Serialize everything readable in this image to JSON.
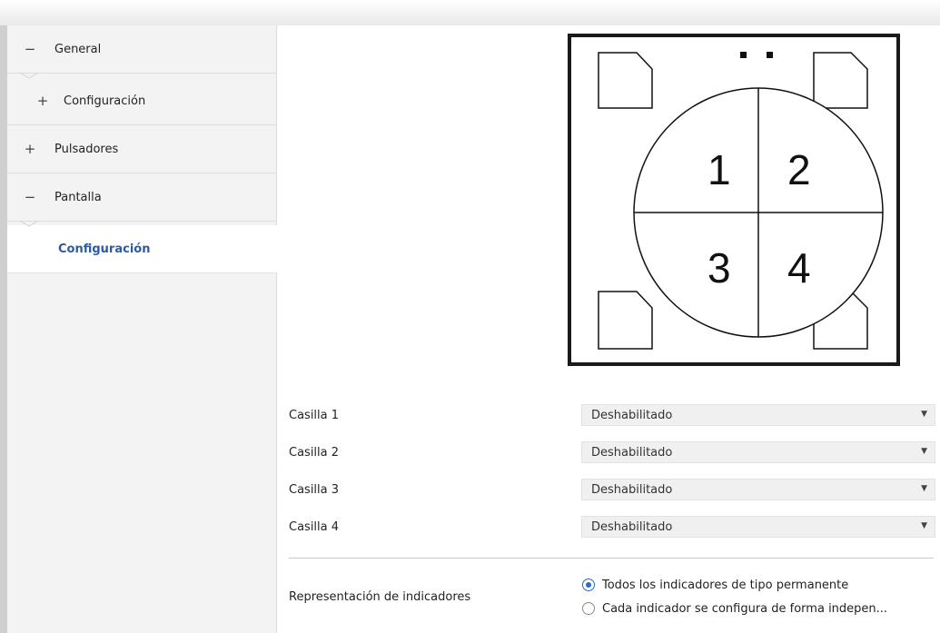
{
  "sidebar": {
    "items": [
      {
        "symbol": "−",
        "label": "General"
      },
      {
        "symbol": "+",
        "label": "Configuración"
      },
      {
        "symbol": "+",
        "label": "Pulsadores"
      },
      {
        "symbol": "−",
        "label": "Pantalla"
      },
      {
        "symbol": "",
        "label": "Configuración"
      }
    ]
  },
  "diagram": {
    "cells": [
      "1",
      "2",
      "3",
      "4"
    ]
  },
  "fields": [
    {
      "label": "Casilla 1",
      "value": "Deshabilitado"
    },
    {
      "label": "Casilla 2",
      "value": "Deshabilitado"
    },
    {
      "label": "Casilla 3",
      "value": "Deshabilitado"
    },
    {
      "label": "Casilla 4",
      "value": "Deshabilitado"
    }
  ],
  "representation": {
    "label": "Representación de indicadores",
    "options": [
      {
        "label": "Todos los indicadores de tipo permanente",
        "checked": true
      },
      {
        "label": "Cada indicador se configura de forma indepen...",
        "checked": false
      }
    ]
  },
  "icons": {
    "dropdown": "chevron-down-icon",
    "expand": "plus-icon",
    "collapse": "minus-icon"
  },
  "colors": {
    "accent": "#2a5ba8",
    "sidebar_bg": "#f3f3f3"
  }
}
